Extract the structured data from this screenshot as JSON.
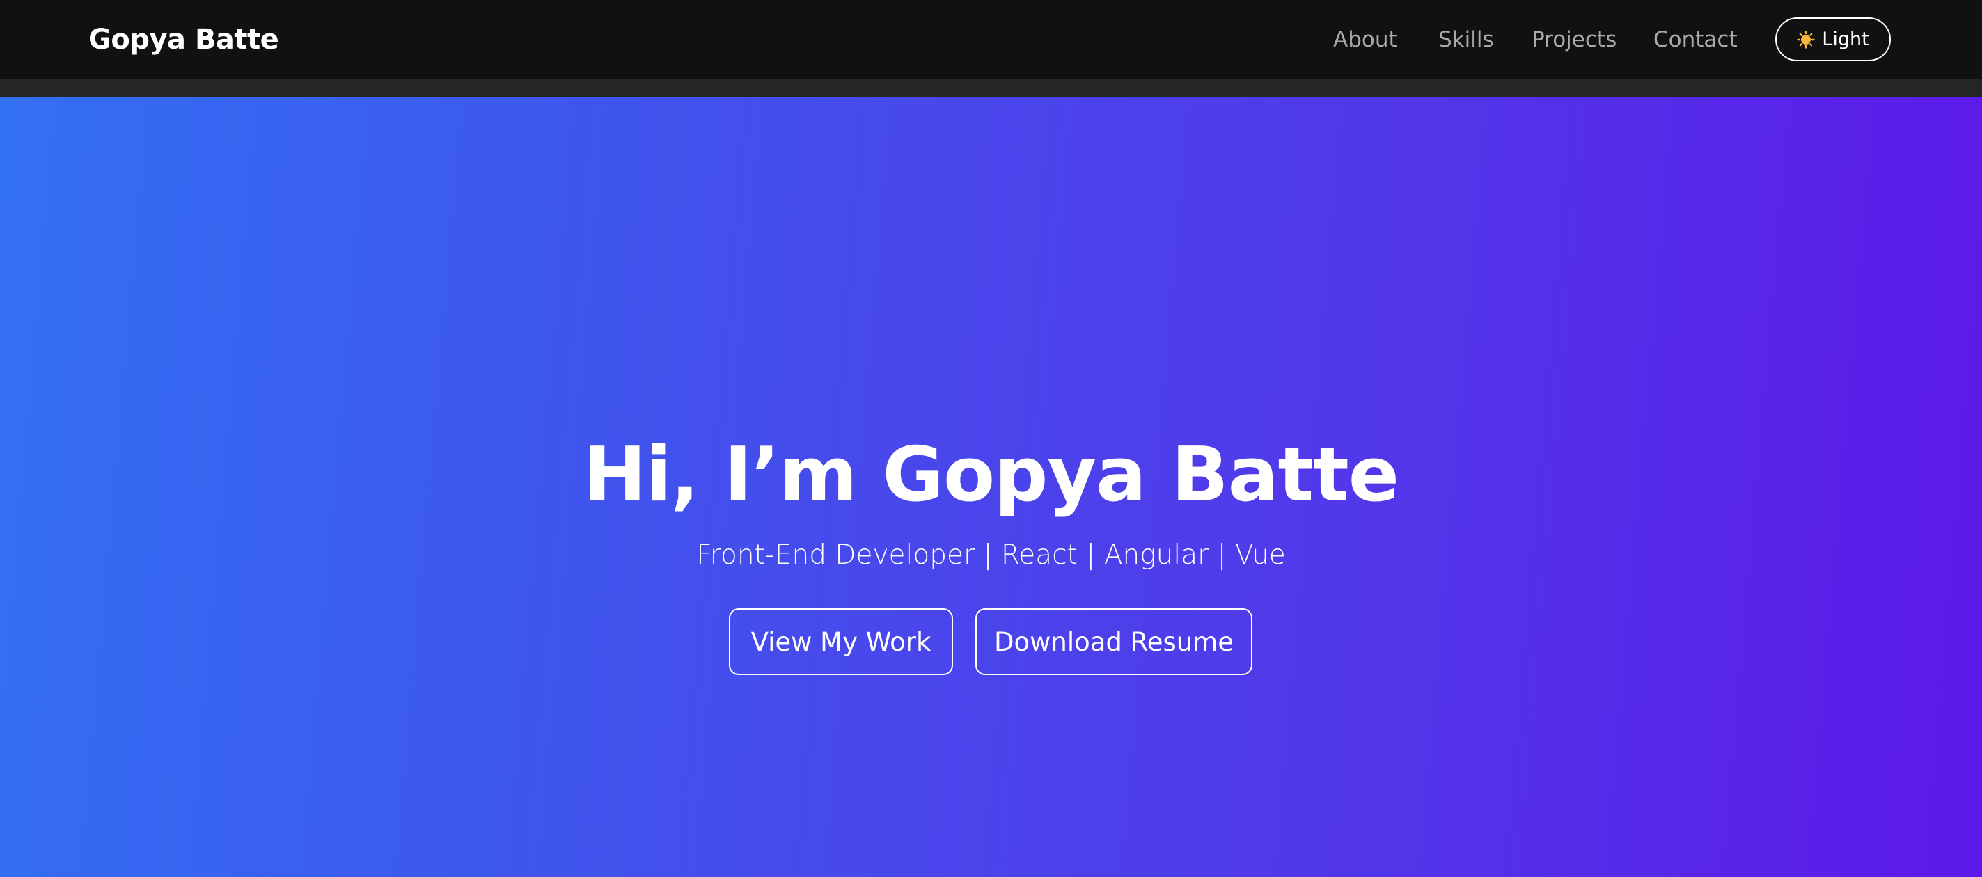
{
  "nav": {
    "brand": "Gopya Batte",
    "links": [
      "About",
      "Skills",
      "Projects",
      "Contact"
    ],
    "theme_toggle": {
      "label": "Light",
      "icon": "sun-icon"
    }
  },
  "hero": {
    "title": "Hi, I’m Gopya Batte",
    "subtitle": "Front-End Developer | React | Angular | Vue",
    "primary_button": "View My Work",
    "secondary_button": "Download Resume"
  },
  "colors": {
    "navbar_bg": "#101111",
    "nav_link": "#a8aaad",
    "hero_gradient_start": "#3370f4",
    "hero_gradient_end": "#5d18e9",
    "text": "#ffffff",
    "sun": "#f6b53c"
  }
}
